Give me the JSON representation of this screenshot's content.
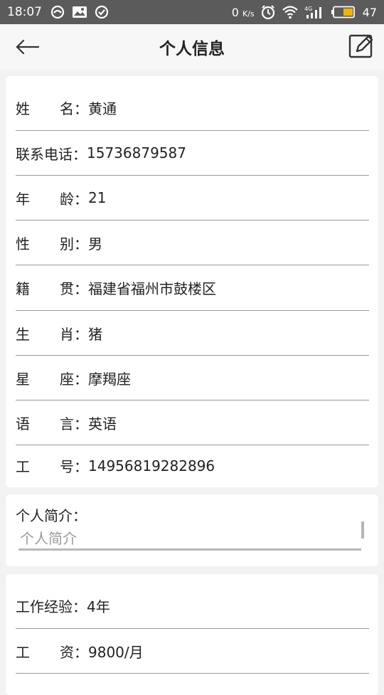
{
  "status_bar": {
    "time": "18:07",
    "net_speed": "0",
    "net_speed_unit": "K/s",
    "network_type": "4G",
    "battery": "47"
  },
  "header": {
    "title": "个人信息"
  },
  "info": {
    "rows": [
      {
        "label_a": "姓",
        "label_b": "名",
        "colon": "：",
        "value": "黄通"
      },
      {
        "label": "联系电话",
        "colon": "：",
        "value": "15736879587"
      },
      {
        "label_a": "年",
        "label_b": "龄",
        "colon": "：",
        "value": "21"
      },
      {
        "label_a": "性",
        "label_b": "别",
        "colon": "：",
        "value": "男"
      },
      {
        "label_a": "籍",
        "label_b": "贯",
        "colon": "：",
        "value": "福建省福州市鼓楼区"
      },
      {
        "label_a": "生",
        "label_b": "肖",
        "colon": "：",
        "value": "猪"
      },
      {
        "label_a": "星",
        "label_b": "座",
        "colon": "：",
        "value": "摩羯座"
      },
      {
        "label_a": "语",
        "label_b": "言",
        "colon": "：",
        "value": "英语"
      },
      {
        "label_a": "工",
        "label_b": "号",
        "colon": "：",
        "value": "14956819282896"
      }
    ]
  },
  "intro": {
    "label": "个人简介：",
    "placeholder": "个人简介",
    "value": ""
  },
  "work": {
    "rows": [
      {
        "label": "工作经验",
        "colon": "：",
        "value": "4年"
      },
      {
        "label_a": "工",
        "label_b": "资",
        "colon": "：",
        "value": "9800/月"
      }
    ]
  },
  "colors": {
    "status_bar": "#5b5b5b",
    "background": "#f2f2f2",
    "card": "#ffffff",
    "divider": "#9a9a9a",
    "battery_fill": "#f0b400"
  }
}
